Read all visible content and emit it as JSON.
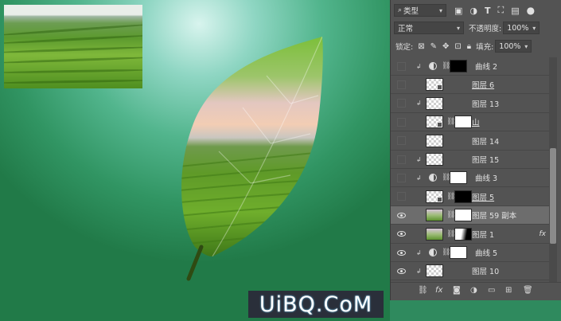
{
  "panel": {
    "filter_kind": "类型",
    "blend_mode": "正常",
    "opacity_label": "不透明度:",
    "opacity_value": "100%",
    "lock_label": "锁定:",
    "fill_label": "填充:",
    "fill_value": "100%"
  },
  "layers": [
    {
      "name": "曲线 2",
      "visible": false,
      "clipped": true,
      "kind": "curves",
      "mask": "black",
      "selected": false,
      "underline": false
    },
    {
      "name": "图层 6",
      "visible": false,
      "clipped": false,
      "kind": "smart",
      "mask": "",
      "selected": false,
      "underline": true
    },
    {
      "name": "图层 13",
      "visible": false,
      "clipped": true,
      "kind": "pixel",
      "mask": "",
      "selected": false,
      "underline": false
    },
    {
      "name": "山",
      "visible": false,
      "clipped": false,
      "kind": "smart",
      "mask": "white",
      "selected": false,
      "underline": true
    },
    {
      "name": "图层 14",
      "visible": false,
      "clipped": false,
      "kind": "pixel",
      "mask": "",
      "selected": false,
      "underline": false
    },
    {
      "name": "图层 15",
      "visible": false,
      "clipped": true,
      "kind": "pixel",
      "mask": "",
      "selected": false,
      "underline": false
    },
    {
      "name": "曲线 3",
      "visible": false,
      "clipped": true,
      "kind": "curves",
      "mask": "white",
      "selected": false,
      "underline": false
    },
    {
      "name": "图层 5",
      "visible": false,
      "clipped": false,
      "kind": "smart",
      "mask": "black",
      "selected": false,
      "underline": true
    },
    {
      "name": "图层 59 副本",
      "visible": true,
      "clipped": false,
      "kind": "photo",
      "mask": "white",
      "selected": true,
      "underline": false
    },
    {
      "name": "图层 1",
      "visible": true,
      "clipped": false,
      "kind": "photo",
      "mask": "grad",
      "selected": false,
      "underline": false,
      "fx": "fx"
    },
    {
      "name": "曲线 5",
      "visible": true,
      "clipped": true,
      "kind": "curves",
      "mask": "white",
      "selected": false,
      "underline": false
    },
    {
      "name": "图层 10",
      "visible": true,
      "clipped": true,
      "kind": "pixel",
      "mask": "",
      "selected": false,
      "underline": false
    }
  ],
  "icons": {
    "search": "search-icon",
    "eye": "eye-icon",
    "link": "link-icon",
    "lock": "lock-icon"
  },
  "watermark": "UiBQ.CoM"
}
